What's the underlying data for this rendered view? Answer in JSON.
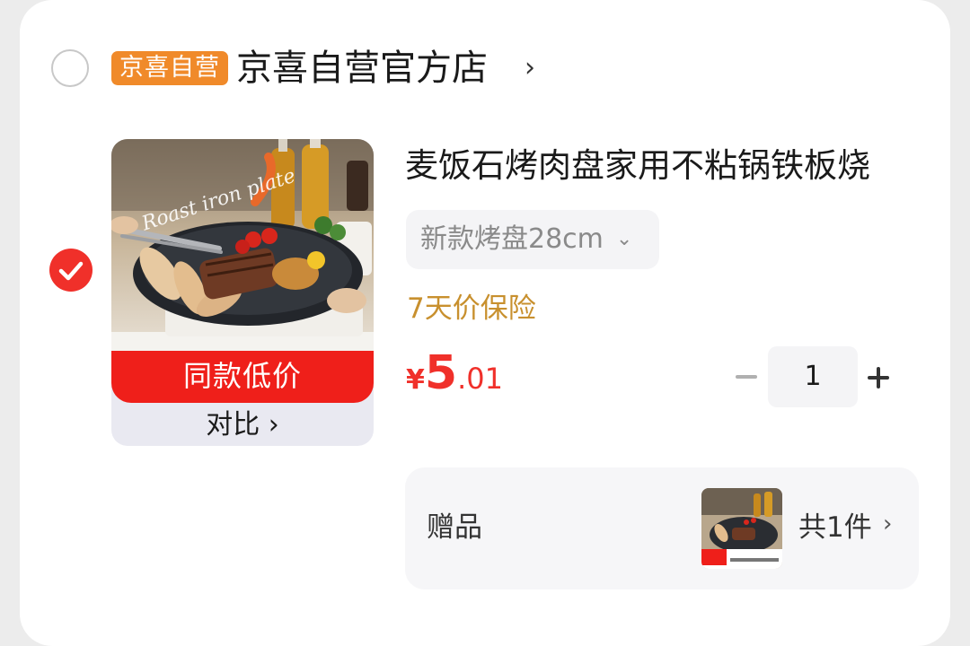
{
  "store": {
    "badge": "京喜自营",
    "name": "京喜自营官方店",
    "chevron": "›",
    "selected": false
  },
  "item": {
    "selected": true,
    "title": "麦饭石烤肉盘家用不粘锅铁板烧",
    "spec": "新款烤盘28cm",
    "spec_chevron": "⌄",
    "guarantee": "7天价保险",
    "price_symbol": "¥",
    "price_integer": "5",
    "price_decimal": ".01",
    "quantity": "1",
    "thumbnail": {
      "script_text": "Roast iron plate",
      "red_banner": "同款低价",
      "compare_link": "对比 ›"
    }
  },
  "gift": {
    "label": "赠品",
    "count": "共1件",
    "chevron": "›"
  },
  "colors": {
    "accent_red": "#f0302a",
    "badge_orange": "#f08a2a",
    "guarantee_gold": "#c8902e"
  }
}
